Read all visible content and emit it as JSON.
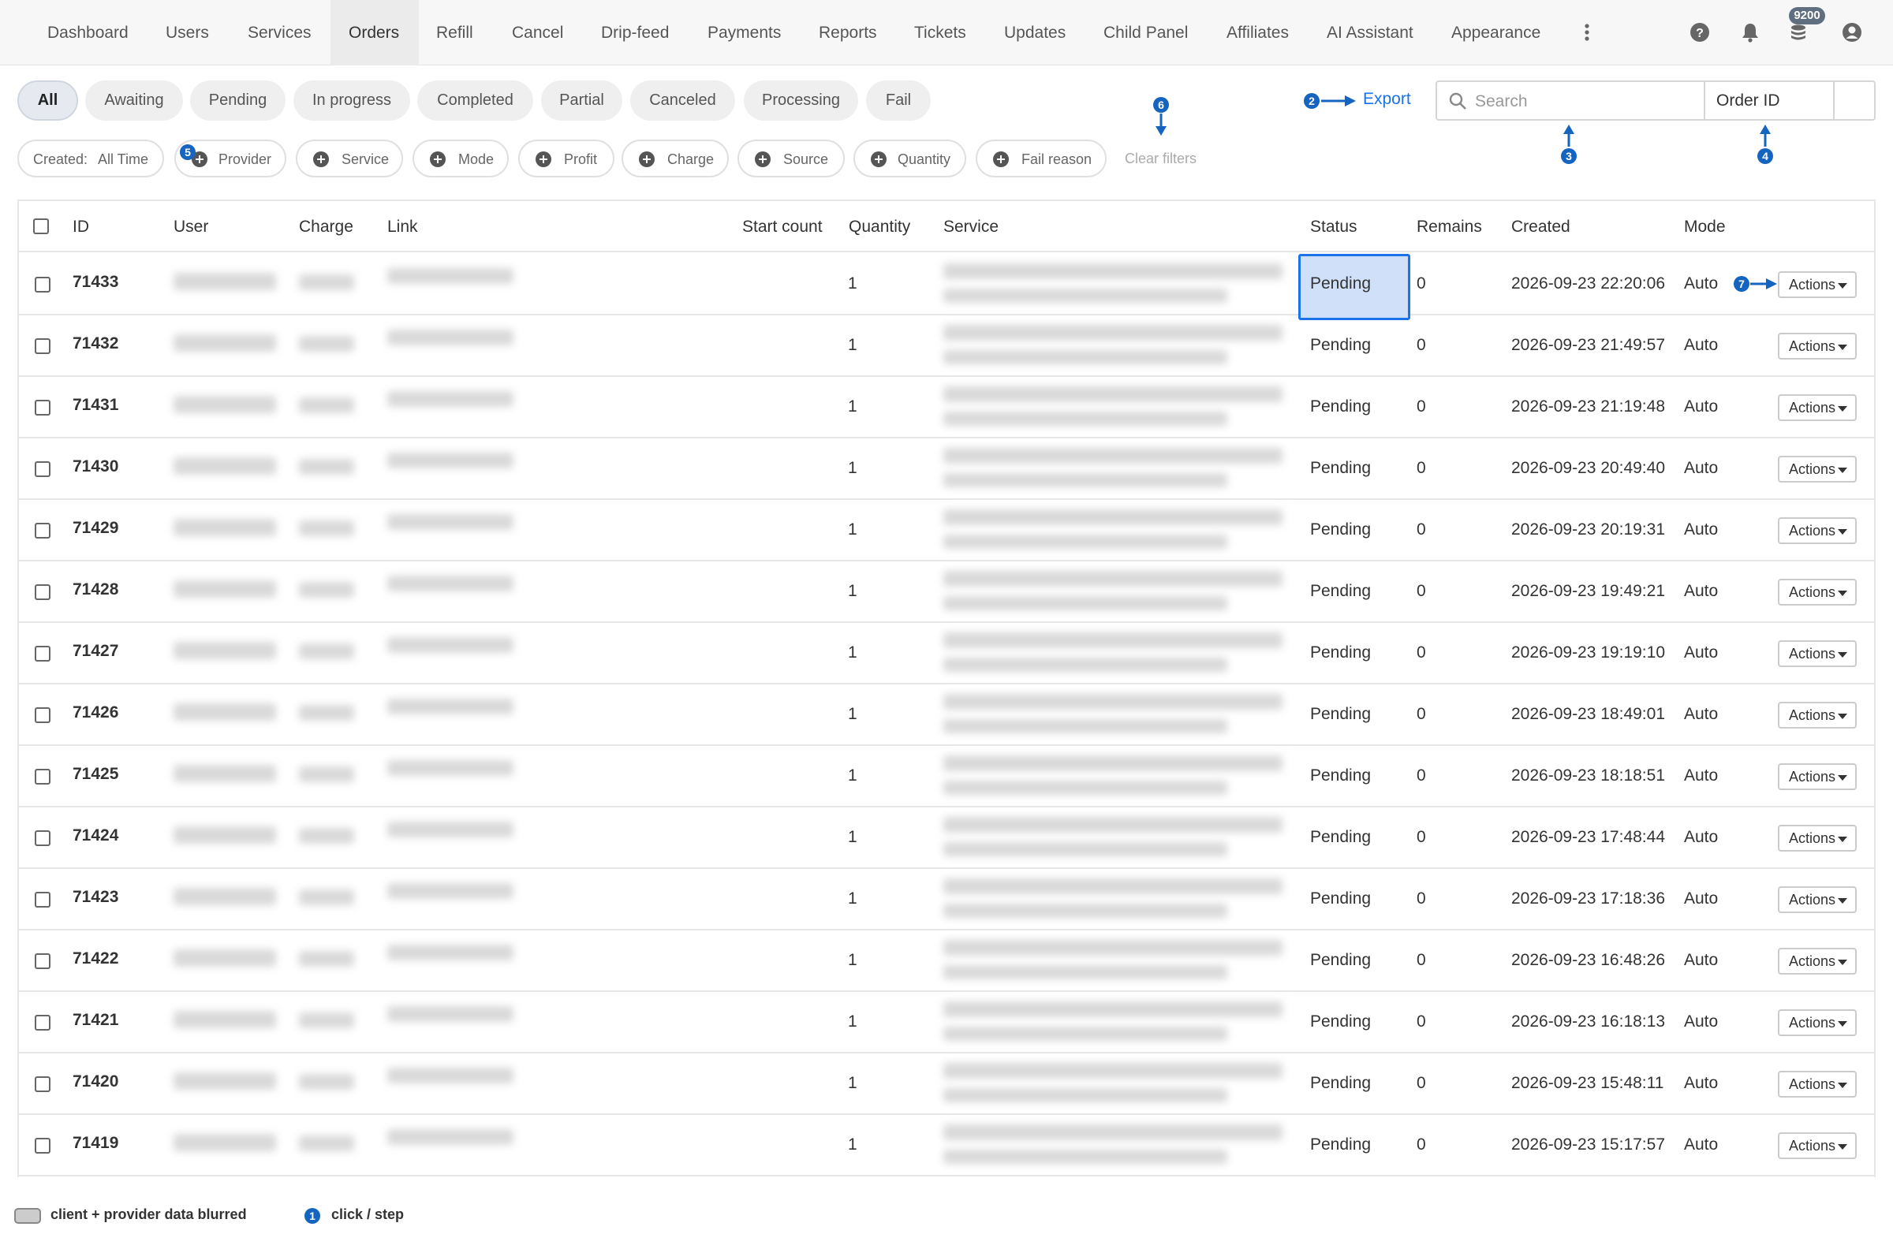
{
  "nav": {
    "items": [
      {
        "label": "Dashboard"
      },
      {
        "label": "Users"
      },
      {
        "label": "Services"
      },
      {
        "label": "Orders"
      },
      {
        "label": "Refill"
      },
      {
        "label": "Cancel"
      },
      {
        "label": "Drip-feed"
      },
      {
        "label": "Payments"
      },
      {
        "label": "Reports"
      },
      {
        "label": "Tickets"
      },
      {
        "label": "Updates"
      },
      {
        "label": "Child Panel"
      },
      {
        "label": "Affiliates"
      },
      {
        "label": "AI Assistant"
      },
      {
        "label": "Appearance"
      }
    ],
    "active": "Orders",
    "icons": [
      "more-vertical-icon",
      "help-icon",
      "bell-icon",
      "balance-stack-icon",
      "account-icon"
    ],
    "balance_badge": "9200"
  },
  "status_tabs": [
    {
      "label": "All"
    },
    {
      "label": "Awaiting"
    },
    {
      "label": "Pending"
    },
    {
      "label": "In progress"
    },
    {
      "label": "Completed"
    },
    {
      "label": "Partial"
    },
    {
      "label": "Canceled"
    },
    {
      "label": "Processing"
    },
    {
      "label": "Fail"
    }
  ],
  "filters": {
    "created_label": "Created:",
    "created_value": "All Time",
    "chips": [
      {
        "label": "Provider"
      },
      {
        "label": "Service"
      },
      {
        "label": "Mode"
      },
      {
        "label": "Profit"
      },
      {
        "label": "Charge"
      },
      {
        "label": "Source"
      },
      {
        "label": "Quantity"
      },
      {
        "label": "Fail reason"
      }
    ],
    "clear": "Clear filters"
  },
  "toolbar": {
    "export_label": "Export",
    "search_placeholder": "Search",
    "search_type": "Order ID"
  },
  "markers": {
    "m2": "2",
    "m3": "3",
    "m4": "4",
    "m5": "5",
    "m6": "6",
    "m7": "7"
  },
  "table": {
    "columns": [
      "ID",
      "User",
      "Charge",
      "Link",
      "Start count",
      "Quantity",
      "Service",
      "Status",
      "Remains",
      "Created",
      "Mode"
    ],
    "rows": [
      {
        "id": "71433",
        "quantity": "1",
        "status": "Pending",
        "remains": "0",
        "created": "2026-09-23 22:20:06",
        "mode": "Auto",
        "action": "Actions"
      },
      {
        "id": "71432",
        "quantity": "1",
        "status": "Pending",
        "remains": "0",
        "created": "2026-09-23 21:49:57",
        "mode": "Auto",
        "action": "Actions"
      },
      {
        "id": "71431",
        "quantity": "1",
        "status": "Pending",
        "remains": "0",
        "created": "2026-09-23 21:19:48",
        "mode": "Auto",
        "action": "Actions"
      },
      {
        "id": "71430",
        "quantity": "1",
        "status": "Pending",
        "remains": "0",
        "created": "2026-09-23 20:49:40",
        "mode": "Auto",
        "action": "Actions"
      },
      {
        "id": "71429",
        "quantity": "1",
        "status": "Pending",
        "remains": "0",
        "created": "2026-09-23 20:19:31",
        "mode": "Auto",
        "action": "Actions"
      },
      {
        "id": "71428",
        "quantity": "1",
        "status": "Pending",
        "remains": "0",
        "created": "2026-09-23 19:49:21",
        "mode": "Auto",
        "action": "Actions"
      },
      {
        "id": "71427",
        "quantity": "1",
        "status": "Pending",
        "remains": "0",
        "created": "2026-09-23 19:19:10",
        "mode": "Auto",
        "action": "Actions"
      },
      {
        "id": "71426",
        "quantity": "1",
        "status": "Pending",
        "remains": "0",
        "created": "2026-09-23 18:49:01",
        "mode": "Auto",
        "action": "Actions"
      },
      {
        "id": "71425",
        "quantity": "1",
        "status": "Pending",
        "remains": "0",
        "created": "2026-09-23 18:18:51",
        "mode": "Auto",
        "action": "Actions"
      },
      {
        "id": "71424",
        "quantity": "1",
        "status": "Pending",
        "remains": "0",
        "created": "2026-09-23 17:48:44",
        "mode": "Auto",
        "action": "Actions"
      },
      {
        "id": "71423",
        "quantity": "1",
        "status": "Pending",
        "remains": "0",
        "created": "2026-09-23 17:18:36",
        "mode": "Auto",
        "action": "Actions"
      },
      {
        "id": "71422",
        "quantity": "1",
        "status": "Pending",
        "remains": "0",
        "created": "2026-09-23 16:48:26",
        "mode": "Auto",
        "action": "Actions"
      },
      {
        "id": "71421",
        "quantity": "1",
        "status": "Pending",
        "remains": "0",
        "created": "2026-09-23 16:18:13",
        "mode": "Auto",
        "action": "Actions"
      },
      {
        "id": "71420",
        "quantity": "1",
        "status": "Pending",
        "remains": "0",
        "created": "2026-09-23 15:48:11",
        "mode": "Auto",
        "action": "Actions"
      },
      {
        "id": "71419",
        "quantity": "1",
        "status": "Pending",
        "remains": "0",
        "created": "2026-09-23 15:17:57",
        "mode": "Auto",
        "action": "Actions"
      }
    ]
  },
  "legend": {
    "blurred_label": "client + provider data blurred",
    "step_marker": "1",
    "step_label": "click / step"
  },
  "colors": {
    "accent": "#1a73e8",
    "marker": "#1565c0",
    "highlight_fill": "#cfe0f8"
  }
}
